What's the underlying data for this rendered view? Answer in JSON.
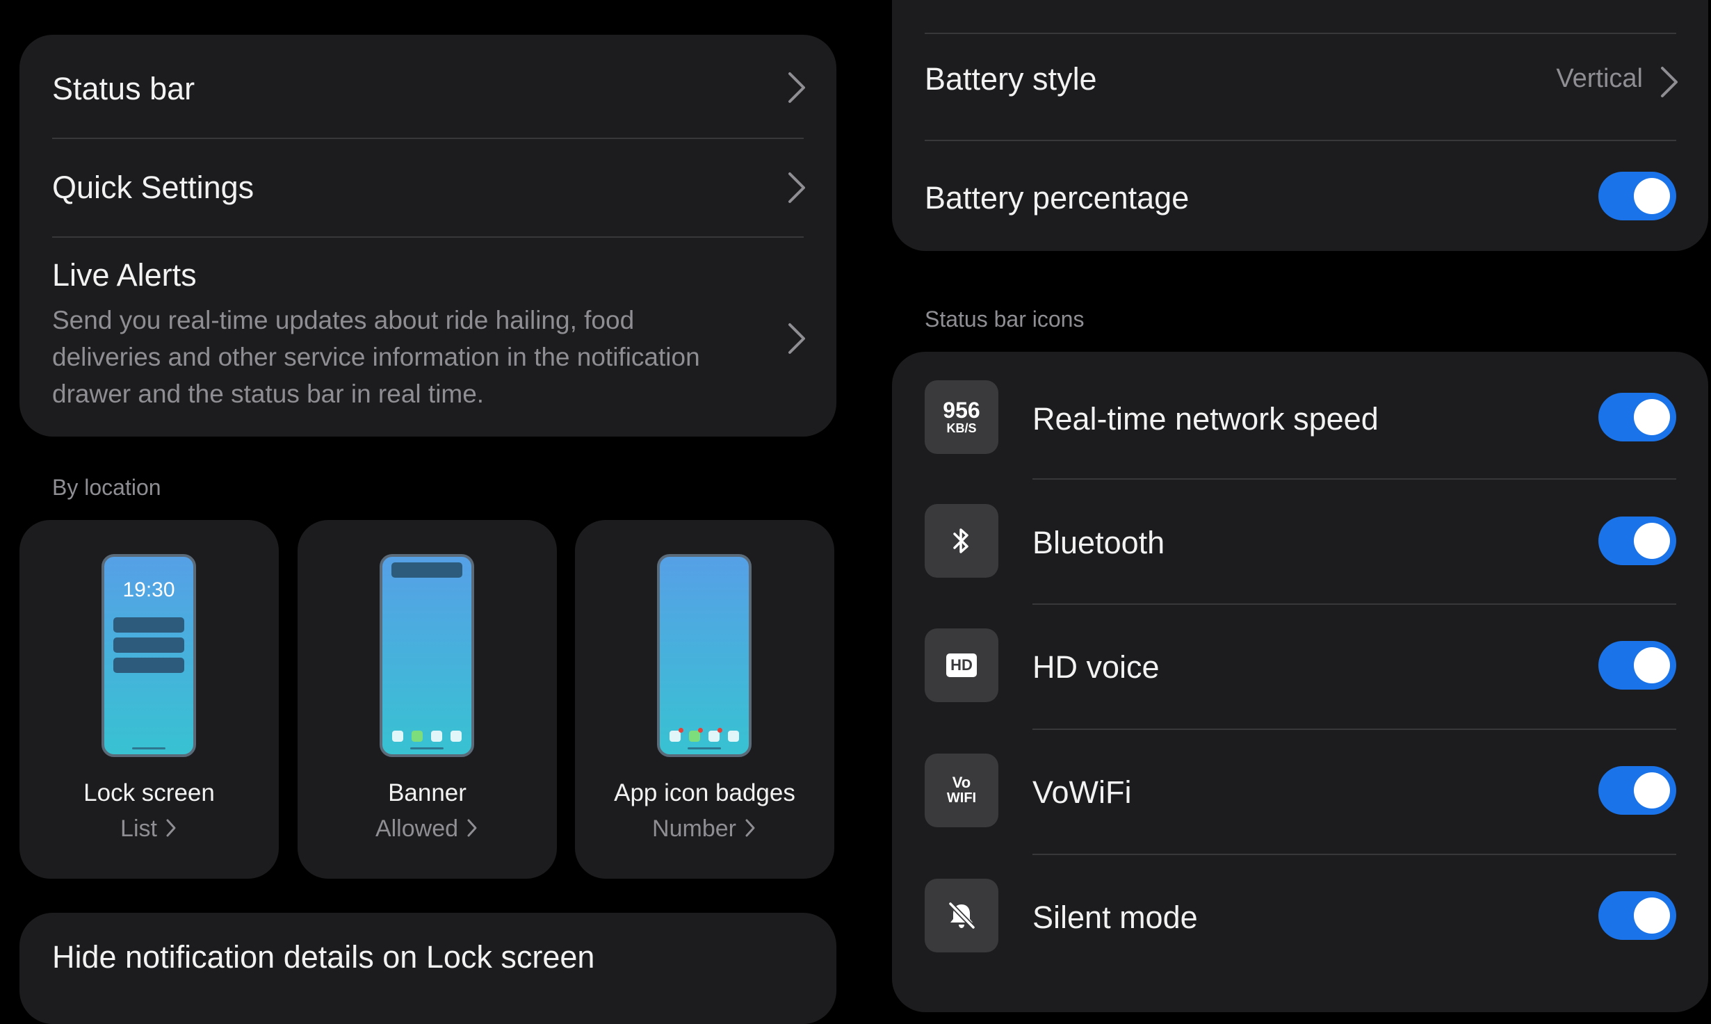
{
  "left": {
    "main_card": {
      "items": [
        {
          "title": "Status bar"
        },
        {
          "title": "Quick Settings"
        },
        {
          "title": "Live Alerts",
          "subtitle": "Send you real-time updates about ride hailing, food deliveries and other service information in the notification drawer and the status bar in real time."
        }
      ]
    },
    "by_location": {
      "label": "By location",
      "tiles": [
        {
          "label": "Lock screen",
          "value": "List",
          "preview_clock": "19:30"
        },
        {
          "label": "Banner",
          "value": "Allowed"
        },
        {
          "label": "App icon badges",
          "value": "Number"
        }
      ]
    },
    "bottom_card": {
      "title": "Hide notification details on Lock screen"
    }
  },
  "right": {
    "battery_card": {
      "battery_style": {
        "title": "Battery style",
        "value": "Vertical"
      },
      "battery_percentage": {
        "title": "Battery percentage",
        "enabled": true
      }
    },
    "status_bar_icons": {
      "label": "Status bar icons",
      "items": [
        {
          "title": "Real-time network speed",
          "icon": "network-speed-icon",
          "icon_top": "956",
          "icon_bottom": "KB/S",
          "enabled": true
        },
        {
          "title": "Bluetooth",
          "icon": "bluetooth-icon",
          "enabled": true
        },
        {
          "title": "HD voice",
          "icon": "hd-voice-icon",
          "icon_text": "HD",
          "enabled": true
        },
        {
          "title": "VoWiFi",
          "icon": "vowifi-icon",
          "icon_top": "Vo",
          "icon_bottom": "WIFI",
          "enabled": true
        },
        {
          "title": "Silent mode",
          "icon": "silent-mode-icon",
          "enabled": true
        }
      ]
    }
  },
  "colors": {
    "background": "#000000",
    "card": "#1c1c1e",
    "toggle_on": "#1a73e8",
    "secondary_text": "#8e8e93"
  }
}
